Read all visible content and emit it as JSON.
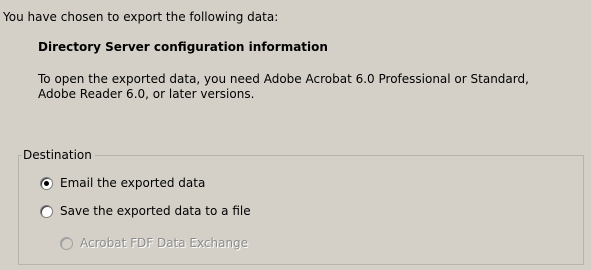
{
  "intro_text": "You have chosen to export the following data:",
  "export_title": "Directory Server configuration information",
  "description_lines": [
    "To open the exported data, you need Adobe Acrobat 6.0 Professional or Standard,",
    "Adobe Reader 6.0, or later versions."
  ],
  "destination": {
    "group_label": "Destination",
    "options": [
      {
        "label": "Email the exported data",
        "selected": true,
        "enabled": true
      },
      {
        "label": "Save the exported data to a file",
        "selected": false,
        "enabled": true
      },
      {
        "label": "Acrobat FDF Data Exchange",
        "selected": false,
        "enabled": false
      }
    ]
  },
  "colors": {
    "background": "#d4d0c8",
    "disabled_text": "#8c8c8c",
    "group_border": "#b8b4ac"
  }
}
